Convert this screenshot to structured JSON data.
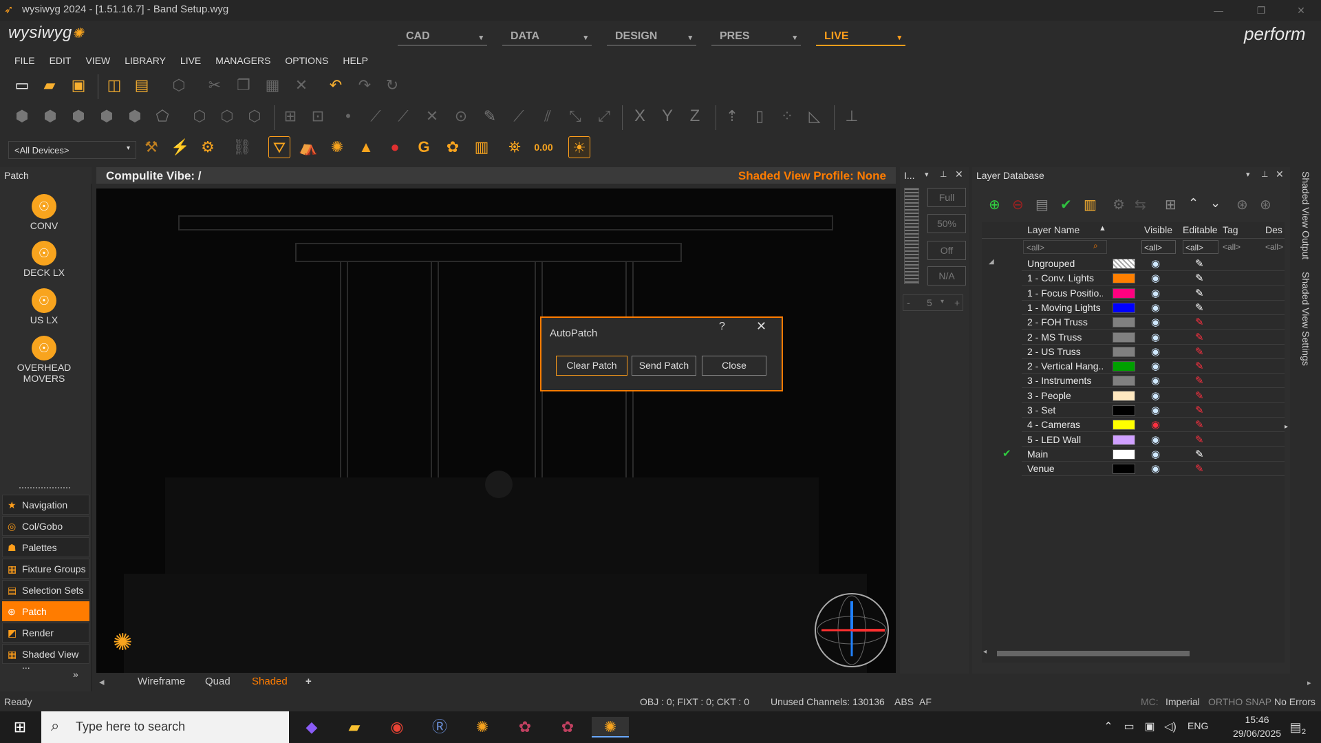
{
  "window": {
    "title": "wysiwyg 2024 - [1.51.16.7] - Band Setup.wyg",
    "logo": "wysiwyg",
    "brand": "perform",
    "controls": [
      "—",
      "❐",
      "✕"
    ]
  },
  "modes": [
    {
      "label": "CAD",
      "arrow": "▾"
    },
    {
      "label": "DATA",
      "arrow": "▾"
    },
    {
      "label": "DESIGN",
      "arrow": "▾"
    },
    {
      "label": "PRES",
      "arrow": "▾"
    },
    {
      "label": "LIVE",
      "arrow": "▾"
    }
  ],
  "menu": [
    "FILE",
    "EDIT",
    "VIEW",
    "LIBRARY",
    "LIVE",
    "MANAGERS",
    "OPTIONS",
    "HELP"
  ],
  "toolbar": {
    "device_filter": "<All Devices>",
    "counter": "0.00",
    "axis": [
      "X",
      "Y",
      "Z"
    ],
    "status_g": "G"
  },
  "patch_panel": {
    "title": "Patch",
    "views": [
      "CONV",
      "DECK LX",
      "US LX",
      "OVERHEAD\nMOVERS"
    ],
    "nav": [
      {
        "label": "Navigation",
        "icon": "★"
      },
      {
        "label": "Col/Gobo",
        "icon": "◎"
      },
      {
        "label": "Palettes",
        "icon": "☗"
      },
      {
        "label": "Fixture Groups",
        "icon": "▦"
      },
      {
        "label": "Selection Sets",
        "icon": "▤"
      },
      {
        "label": "Patch",
        "icon": "⊛"
      },
      {
        "label": "Render",
        "icon": "◩"
      },
      {
        "label": "Shaded View ...",
        "icon": "▦"
      }
    ],
    "expand": "»"
  },
  "viewport": {
    "title": "Compulite Vibe: /",
    "profile": "Shaded View Profile: None",
    "tabs": [
      "Wireframe",
      "Quad",
      "Shaded"
    ],
    "add_tab": "+"
  },
  "dialog": {
    "title": "AutoPatch",
    "help": "?",
    "close": "✕",
    "buttons": [
      "Clear Patch",
      "Send Patch",
      "Close"
    ]
  },
  "mid_panel": {
    "title": "I...",
    "buttons": [
      "Full",
      "50%",
      "Off",
      "N/A"
    ],
    "value": "5"
  },
  "layer_db": {
    "title": "Layer Database",
    "columns": {
      "name": "Layer Name",
      "visible": "Visible",
      "editable": "Editable",
      "tag": "Tag",
      "desc": "Des"
    },
    "filters": {
      "name": "<all>",
      "visible": "<all>",
      "editable": "<all>",
      "tag": "<all>",
      "desc": "<all>"
    },
    "rows": [
      {
        "name": "Ungrouped",
        "color": "#ffffff",
        "hatched": true,
        "visible": "◉",
        "editable": "✎",
        "locked": false
      },
      {
        "name": "1 - Conv. Lights",
        "color": "#ff7f00",
        "visible": "◉",
        "editable": "✎",
        "locked": false
      },
      {
        "name": "1 - Focus Positio...",
        "color": "#ff0080",
        "visible": "◉",
        "editable": "✎",
        "locked": false
      },
      {
        "name": "1 - Moving Lights",
        "color": "#0000ff",
        "visible": "◉",
        "editable": "✎",
        "locked": false
      },
      {
        "name": "2 - FOH Truss",
        "color": "#808080",
        "visible": "◉",
        "editable": "✎",
        "locked": true
      },
      {
        "name": "2 - MS Truss",
        "color": "#808080",
        "visible": "◉",
        "editable": "✎",
        "locked": true
      },
      {
        "name": "2 - US Truss",
        "color": "#808080",
        "visible": "◉",
        "editable": "✎",
        "locked": true
      },
      {
        "name": "2 - Vertical Hang...",
        "color": "#00a000",
        "visible": "◉",
        "editable": "✎",
        "locked": true
      },
      {
        "name": "3 - Instruments",
        "color": "#808080",
        "visible": "◉",
        "editable": "✎",
        "locked": true
      },
      {
        "name": "3 - People",
        "color": "#ffe8c0",
        "visible": "◉",
        "editable": "✎",
        "locked": true
      },
      {
        "name": "3 - Set",
        "color": "#000000",
        "visible": "◉",
        "editable": "✎",
        "locked": true
      },
      {
        "name": "4 - Cameras",
        "color": "#ffff00",
        "visible": "◉",
        "editable": "✎",
        "locked": true,
        "hidden": true
      },
      {
        "name": "5 - LED Wall",
        "color": "#d0a0ff",
        "visible": "◉",
        "editable": "✎",
        "locked": true
      },
      {
        "name": "Main",
        "color": "#ffffff",
        "visible": "◉",
        "editable": "✎",
        "locked": false,
        "current": true
      },
      {
        "name": "Venue",
        "color": "#000000",
        "visible": "◉",
        "editable": "✎",
        "locked": true
      }
    ]
  },
  "side_tabs": [
    "Shaded View Output",
    "Shaded View Settings"
  ],
  "status": {
    "ready": "Ready",
    "counts": "OBJ : 0; FIXT : 0; CKT : 0",
    "unused": "Unused Channels: 130136",
    "abs": "ABS",
    "af": "AF",
    "mc": "MC:",
    "units": "Imperial",
    "ortho": "ORTHO",
    "snap": "SNAP",
    "errors": "No Errors"
  },
  "taskbar": {
    "search_placeholder": "Type here to search",
    "lang": "ENG",
    "time": "15:46",
    "date": "29/06/2025",
    "notif": "2"
  }
}
